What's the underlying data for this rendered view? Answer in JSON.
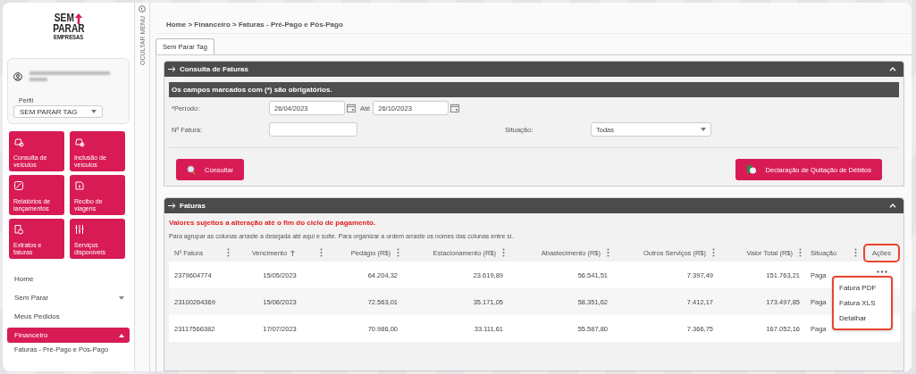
{
  "logo": {
    "line1": "SEM",
    "line2": "PARAR",
    "sub": "EMPRESAS"
  },
  "profile": {
    "label": "Perfil",
    "value": "SEM PARAR TAG"
  },
  "tiles": [
    {
      "label": "Consulta de veículos"
    },
    {
      "label": "Inclusão de veículos"
    },
    {
      "label": "Relatórios de lançamentos"
    },
    {
      "label": "Recibo de viagens"
    },
    {
      "label": "Extratos e faturas"
    },
    {
      "label": "Serviços disponíveis"
    }
  ],
  "nav": [
    {
      "label": "Home",
      "selected": false
    },
    {
      "label": "Sem Parar",
      "selected": false,
      "expanded": false
    },
    {
      "label": "Meus Pedidos",
      "selected": false
    },
    {
      "label": "Financeiro",
      "selected": true,
      "expanded": true
    }
  ],
  "subnav": "Faturas - Pré-Pago e Pós-Pago",
  "hide_menu": "OCULTAR MENU",
  "breadcrumb": "Home > Financeiro > Faturas - Pré-Pago e Pós-Pago",
  "tabs": [
    {
      "label": "Sem Parar Tag",
      "selected": true
    }
  ],
  "search_panel": {
    "title": "Consulta de Faturas",
    "notice": "Os campos marcados com (*) são obrigatórios.",
    "period_label": "*Período:",
    "date_from": "26/04/2023",
    "until_label": "Até",
    "date_to": "26/10/2023",
    "invoice_label": "Nº Fatura:",
    "status_label": "Situação:",
    "status_value": "Todas",
    "search_button": "Consultar",
    "declaration_button": "Declaração de Quitação de Débitos"
  },
  "invoices_panel": {
    "title": "Faturas",
    "warning": "Valores sujeitos a alteração até o fim do ciclo de pagamento.",
    "hint": "Para agrupar as colunas arraste a desejada até aqui e solte. Para organizar a ordem arraste os nomes das colunas entre si.",
    "columns": [
      {
        "label": "Nº Fatura",
        "sorted": false,
        "highlighted": false
      },
      {
        "label": "Vencimento",
        "sorted": true,
        "highlighted": false
      },
      {
        "label": "Pedágio (R$)",
        "sorted": false,
        "highlighted": false
      },
      {
        "label": "Estacionamento (R$)",
        "sorted": false,
        "highlighted": false
      },
      {
        "label": "Abastecimento (R$)",
        "sorted": false,
        "highlighted": false
      },
      {
        "label": "Outros Serviços (R$)",
        "sorted": false,
        "highlighted": false
      },
      {
        "label": "Valor Total (R$)",
        "sorted": false,
        "highlighted": false
      },
      {
        "label": "Situação",
        "sorted": false,
        "highlighted": false
      },
      {
        "label": "Ações",
        "sorted": false,
        "highlighted": true
      }
    ],
    "rows": [
      {
        "cells": [
          "2379604774",
          "15/05/2023",
          "64.204,32",
          "23.619,89",
          "56.541,51",
          "7.397,49",
          "151.763,21",
          "Paga"
        ],
        "actions_visible": true
      },
      {
        "cells": [
          "23100264369",
          "15/06/2023",
          "72.563,01",
          "35.171,05",
          "58.351,62",
          "7.412,17",
          "173.497,85",
          "Paga"
        ]
      },
      {
        "cells": [
          "23117566382",
          "17/07/2023",
          "70.986,00",
          "33.111,61",
          "55.587,80",
          "7.366,75",
          "167.052,16",
          "Paga"
        ]
      }
    ],
    "menu": {
      "highlighted": true,
      "items": [
        "Fatura PDF",
        "Fatura XLS",
        "Detalhar"
      ]
    }
  }
}
